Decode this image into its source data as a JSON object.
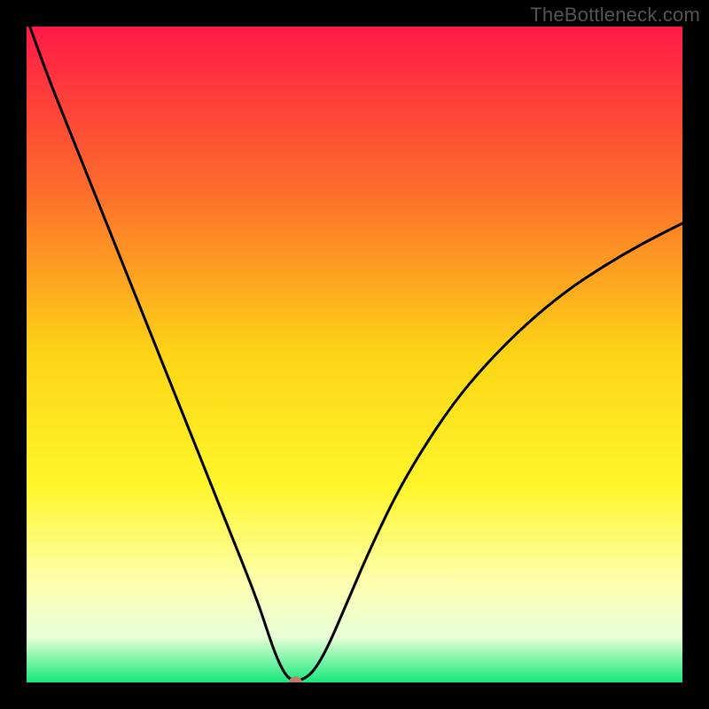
{
  "watermark": "TheBottleneck.com",
  "chart_data": {
    "type": "line",
    "title": "",
    "xlabel": "",
    "ylabel": "",
    "xlim": [
      0,
      100
    ],
    "ylim": [
      0,
      100
    ],
    "grid": false,
    "background_gradient": {
      "stops": [
        {
          "offset": 0,
          "color": "#ff1a47"
        },
        {
          "offset": 25,
          "color": "#fd6d2b"
        },
        {
          "offset": 50,
          "color": "#fdd516"
        },
        {
          "offset": 70,
          "color": "#fff62a"
        },
        {
          "offset": 85,
          "color": "#fdffb0"
        },
        {
          "offset": 93,
          "color": "#e9ffd8"
        },
        {
          "offset": 100,
          "color": "#17e87a"
        }
      ]
    },
    "series": [
      {
        "name": "bottleneck-curve",
        "color": "#000000",
        "x": [
          0.5,
          3,
          6,
          9,
          12,
          15,
          18,
          21,
          24,
          27,
          30,
          32,
          34,
          35.5,
          36.5,
          37.5,
          38.5,
          39.3,
          40.0,
          41.0,
          42.5,
          44.0,
          46.0,
          49.0,
          52.0,
          56.0,
          60.0,
          65.0,
          70.0,
          76.0,
          82.0,
          88.0,
          94.0,
          100.0
        ],
        "y": [
          100,
          93,
          85.5,
          78,
          70.5,
          63,
          55.5,
          48,
          40.5,
          33,
          25.5,
          20.5,
          15.5,
          11.5,
          8.5,
          5.5,
          3.0,
          1.5,
          0.6,
          0.2,
          0.6,
          2.0,
          5.5,
          12.5,
          19.5,
          28.0,
          35.0,
          42.5,
          48.5,
          54.5,
          59.5,
          63.5,
          67.0,
          70.0
        ]
      }
    ],
    "marker": {
      "name": "min-bottleneck-marker",
      "x": 41.0,
      "y": 0.2,
      "color": "#c47b63",
      "rx": 7,
      "ry": 5
    }
  }
}
